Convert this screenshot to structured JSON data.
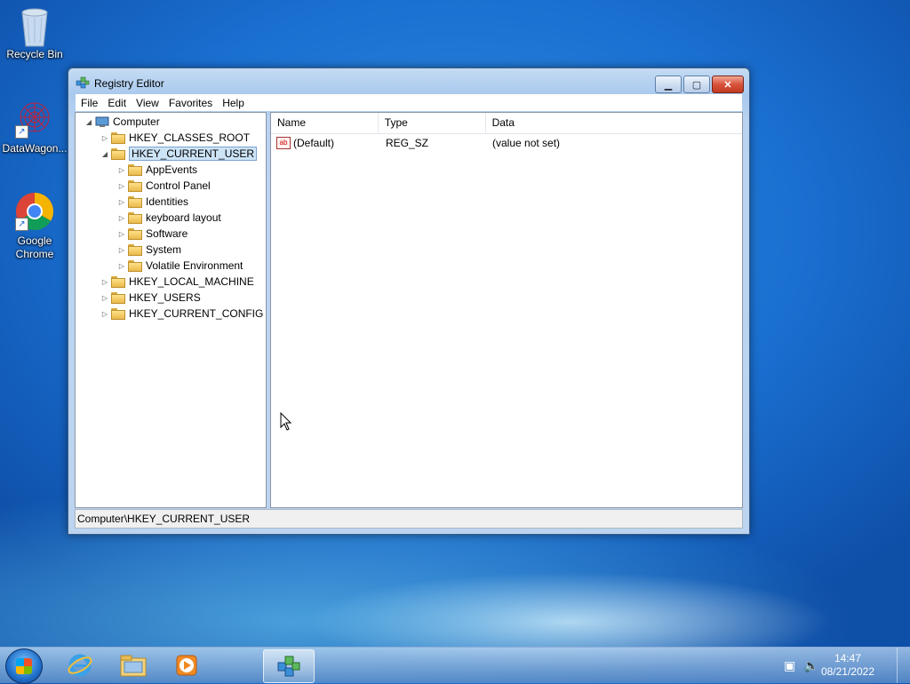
{
  "desktop": {
    "icons": [
      {
        "label": "Recycle Bin",
        "icon": "recycle-bin-icon"
      },
      {
        "label": "DataWagon...",
        "icon": "datawagon-icon"
      },
      {
        "label": "Google Chrome",
        "icon": "chrome-icon"
      }
    ]
  },
  "window": {
    "title": "Registry Editor",
    "controls": {
      "minimize": "▁",
      "maximize": "▢",
      "close": "✕"
    },
    "menu": [
      "File",
      "Edit",
      "View",
      "Favorites",
      "Help"
    ],
    "tree": {
      "root": "Computer",
      "hives": [
        {
          "label": "HKEY_CLASSES_ROOT"
        },
        {
          "label": "HKEY_CURRENT_USER",
          "expanded": true,
          "selected": true,
          "children": [
            "AppEvents",
            "Control Panel",
            "Identities",
            "keyboard layout",
            "Software",
            "System",
            "Volatile Environment"
          ]
        },
        {
          "label": "HKEY_LOCAL_MACHINE"
        },
        {
          "label": "HKEY_USERS"
        },
        {
          "label": "HKEY_CURRENT_CONFIG"
        }
      ]
    },
    "list": {
      "columns": [
        "Name",
        "Type",
        "Data"
      ],
      "rows": [
        {
          "name": "(Default)",
          "type": "REG_SZ",
          "data": "(value not set)",
          "icon": "string-value-icon"
        }
      ]
    },
    "status": "Computer\\HKEY_CURRENT_USER"
  },
  "taskbar": {
    "items": [
      "start-button",
      "internet-explorer-icon",
      "file-explorer-icon",
      "media-player-icon",
      "regedit-icon"
    ],
    "clock": {
      "time": "14:47",
      "date": "08/21/2022"
    },
    "tray": [
      "network-icon",
      "volume-icon"
    ]
  },
  "colors": {
    "desktop": "#1a6fd0",
    "selection": "#cde4f7",
    "close": "#c23a22"
  }
}
